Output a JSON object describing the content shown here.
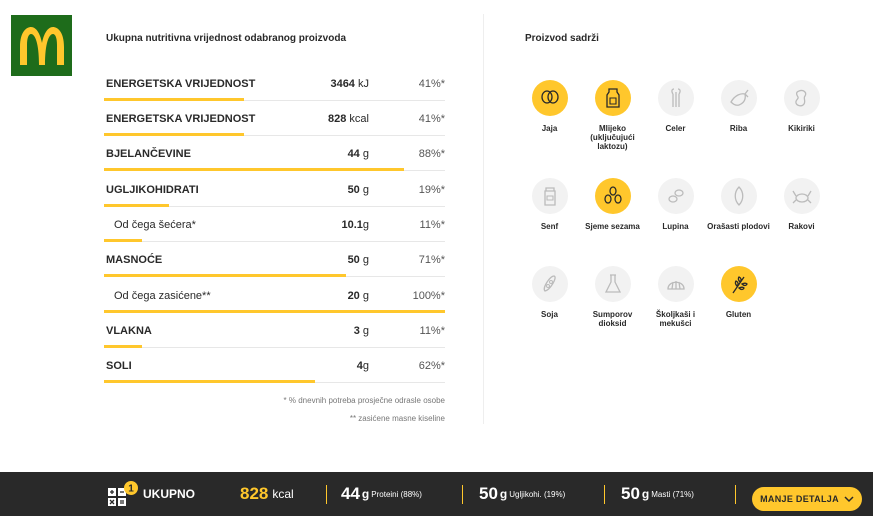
{
  "brand": {
    "logo_letter": "M",
    "bg_color": "#1e6c1b",
    "arch_color": "#ffc72c"
  },
  "nutrition": {
    "title": "Ukupna nutritivna vrijednost odabranog proizvoda",
    "rows": [
      {
        "name": "ENERGETSKA VRIJEDNOST",
        "amount": "3464",
        "unit": " kJ",
        "percent": "41%*",
        "bar_fraction": 0.41
      },
      {
        "name": "ENERGETSKA VRIJEDNOST",
        "amount": "828",
        "unit": " kcal",
        "percent": "41%*",
        "bar_fraction": 0.41
      },
      {
        "name": "BJELANČEVINE",
        "amount": "44",
        "unit": " g",
        "percent": "88%*",
        "bar_fraction": 0.88
      },
      {
        "name": "UGLJIKOHIDRATI",
        "amount": "50",
        "unit": " g",
        "percent": "19%*",
        "bar_fraction": 0.19
      },
      {
        "name": "Od čega šećera*",
        "amount": "10.1",
        "unit": "g",
        "percent": "11%*",
        "bar_fraction": 0.11
      },
      {
        "name": "MASNOĆE",
        "amount": "50",
        "unit": " g",
        "percent": "71%*",
        "bar_fraction": 0.71
      },
      {
        "name": "Od čega zasićene**",
        "amount": "20",
        "unit": " g",
        "percent": "100%*",
        "bar_fraction": 1.0
      },
      {
        "name": "VLAKNA",
        "amount": "3",
        "unit": " g",
        "percent": "11%*",
        "bar_fraction": 0.11
      },
      {
        "name": "SOLI",
        "amount": "4",
        "unit": "g",
        "percent": "62%*",
        "bar_fraction": 0.62
      }
    ],
    "note1": "* % dnevnih potreba prosječne odrasle osobe",
    "note2": "** zasićene masne kiseline"
  },
  "allergens": {
    "title": "Proizvod sadrži",
    "items": [
      {
        "label": "Jaja",
        "icon": "egg-icon",
        "active": true
      },
      {
        "label": "Mlijeko (uključujući laktozu)",
        "icon": "milk-icon",
        "active": true
      },
      {
        "label": "Celer",
        "icon": "celery-icon",
        "active": false
      },
      {
        "label": "Riba",
        "icon": "fish-icon",
        "active": false
      },
      {
        "label": "Kikiriki",
        "icon": "peanut-icon",
        "active": false
      },
      {
        "label": "Senf",
        "icon": "mustard-icon",
        "active": false
      },
      {
        "label": "Sjeme sezama",
        "icon": "sesame-icon",
        "active": true
      },
      {
        "label": "Lupina",
        "icon": "lupin-icon",
        "active": false
      },
      {
        "label": "Orašasti plodovi",
        "icon": "nut-icon",
        "active": false
      },
      {
        "label": "Rakovi",
        "icon": "crab-icon",
        "active": false
      },
      {
        "label": "Soja",
        "icon": "soy-icon",
        "active": false
      },
      {
        "label": "Sumporov dioksid",
        "icon": "flask-icon",
        "active": false
      },
      {
        "label": "Školjkaši i mekušci",
        "icon": "shell-icon",
        "active": false
      },
      {
        "label": "Gluten",
        "icon": "wheat-icon",
        "active": true
      }
    ]
  },
  "summary": {
    "badge": "1",
    "label": "UKUPNO",
    "kcal_value": "828",
    "kcal_unit": "kcal",
    "protein_value": "44",
    "protein_unit": "g",
    "protein_label": "Proteini (88%)",
    "carbs_value": "50",
    "carbs_unit": "g",
    "carbs_label": "Ugljikohi. (19%)",
    "fat_value": "50",
    "fat_unit": "g",
    "fat_label": "Masti (71%)",
    "button_label": "MANJE DETALJA"
  }
}
